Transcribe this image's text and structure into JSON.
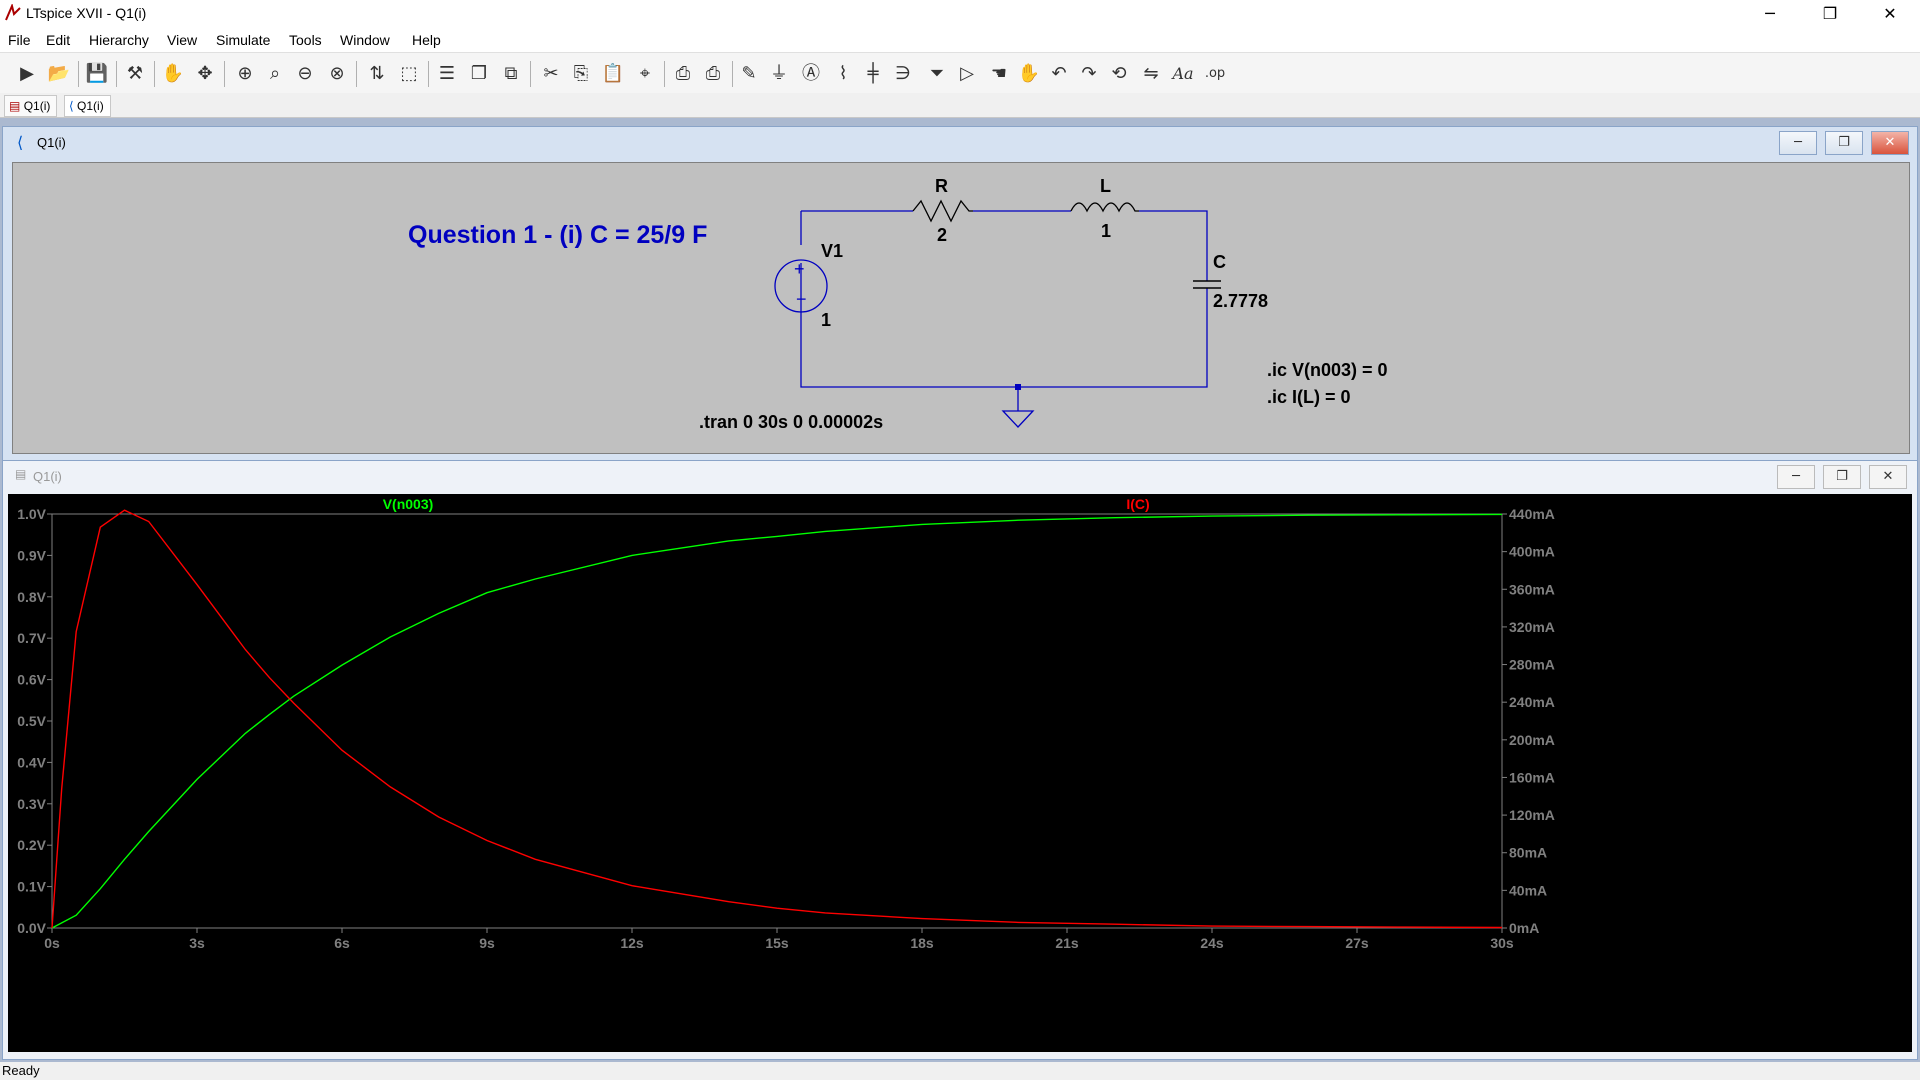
{
  "window": {
    "title": "LTspice XVII - Q1(i)",
    "min_icon": "─",
    "max_icon": "❐",
    "close_icon": "✕"
  },
  "menu": [
    "File",
    "Edit",
    "Hierarchy",
    "View",
    "Simulate",
    "Tools",
    "Window",
    "Help"
  ],
  "toolbar": {
    "icons": [
      "run-icon",
      "open-icon",
      "save-icon",
      "control-panel-icon",
      "halt-icon",
      "pan-icon",
      "zoom-in-icon",
      "zoom-full-icon",
      "zoom-out-icon",
      "zoom-cancel-icon",
      "autorange-icon",
      "edit-plot-icon",
      "tile-horizontal-icon",
      "cascade-icon",
      "close-all-icon",
      "cut-icon",
      "copy-icon",
      "paste-icon",
      "find-icon",
      "print-icon",
      "print-setup-icon",
      "draw-wire-icon",
      "ground-icon",
      "label-net-icon",
      "resistor-icon",
      "capacitor-icon",
      "inductor-icon",
      "diode-icon",
      "component-icon",
      "move-icon",
      "drag-icon",
      "undo-icon",
      "redo-icon",
      "rotate-icon",
      "mirror-icon",
      "text-icon",
      "spice-directive-icon"
    ],
    "spice_directive_label": ".op",
    "text_label": "Aa"
  },
  "tabs": [
    {
      "label": "Q1(i)",
      "icon": "waveform-icon"
    },
    {
      "label": "Q1(i)",
      "icon": "schematic-icon"
    }
  ],
  "schematic_window": {
    "title": "Q1(i)"
  },
  "plot_window": {
    "title": "Q1(i)"
  },
  "schematic": {
    "heading": "Question 1 - (i) C = 25/9 F",
    "v1_name": "V1",
    "v1_value": "1",
    "r_name": "R",
    "r_value": "2",
    "l_name": "L",
    "l_value": "1",
    "c_name": "C",
    "c_value": "2.7778",
    "tran_directive": ".tran 0 30s 0 0.00002s",
    "ic1": ".ic V(n003) = 0",
    "ic2": ".ic I(L) = 0",
    "colors": {
      "heading": "#0000c0",
      "wire": "#0000c0",
      "component": "#000000"
    }
  },
  "chart_data": {
    "type": "line",
    "x_label_ticks": [
      "0s",
      "3s",
      "6s",
      "9s",
      "12s",
      "15s",
      "18s",
      "21s",
      "24s",
      "27s",
      "30s"
    ],
    "x_range": [
      0,
      30
    ],
    "left_axis": {
      "ticks": [
        "0.0V",
        "0.1V",
        "0.2V",
        "0.3V",
        "0.4V",
        "0.5V",
        "0.6V",
        "0.7V",
        "0.8V",
        "0.9V",
        "1.0V"
      ],
      "range": [
        0,
        1.0
      ]
    },
    "right_axis": {
      "ticks": [
        "0mA",
        "40mA",
        "80mA",
        "120mA",
        "160mA",
        "200mA",
        "240mA",
        "280mA",
        "320mA",
        "360mA",
        "400mA",
        "440mA"
      ],
      "range": [
        0,
        440
      ]
    },
    "series": [
      {
        "name": "V(n003)",
        "axis": "left",
        "color": "#00ff00",
        "x": [
          0,
          0.5,
          1,
          1.5,
          2,
          3,
          4,
          4.5,
          5,
          6,
          7,
          8,
          9,
          10,
          12,
          14,
          15,
          16,
          18,
          20,
          22,
          24,
          26,
          28,
          30
        ],
        "y": [
          0,
          0.031,
          0.095,
          0.166,
          0.233,
          0.359,
          0.47,
          0.516,
          0.56,
          0.635,
          0.703,
          0.76,
          0.81,
          0.843,
          0.9,
          0.935,
          0.946,
          0.958,
          0.975,
          0.985,
          0.991,
          0.995,
          0.997,
          0.998,
          0.999
        ]
      },
      {
        "name": "I(C)",
        "axis": "right",
        "color": "#ff0000",
        "x": [
          0,
          0.2,
          0.5,
          1,
          1.5,
          2,
          3,
          4,
          4.5,
          5,
          6,
          7,
          8,
          9,
          10,
          12,
          14,
          15,
          16,
          18,
          20,
          22,
          24,
          26,
          28,
          30
        ],
        "y": [
          0,
          148,
          315,
          426,
          444,
          432,
          365,
          296,
          266,
          239,
          189,
          150,
          118,
          93,
          73,
          45,
          28,
          21,
          16,
          10,
          6,
          4,
          2,
          1.5,
          1,
          0.5
        ]
      }
    ]
  },
  "status": "Ready"
}
